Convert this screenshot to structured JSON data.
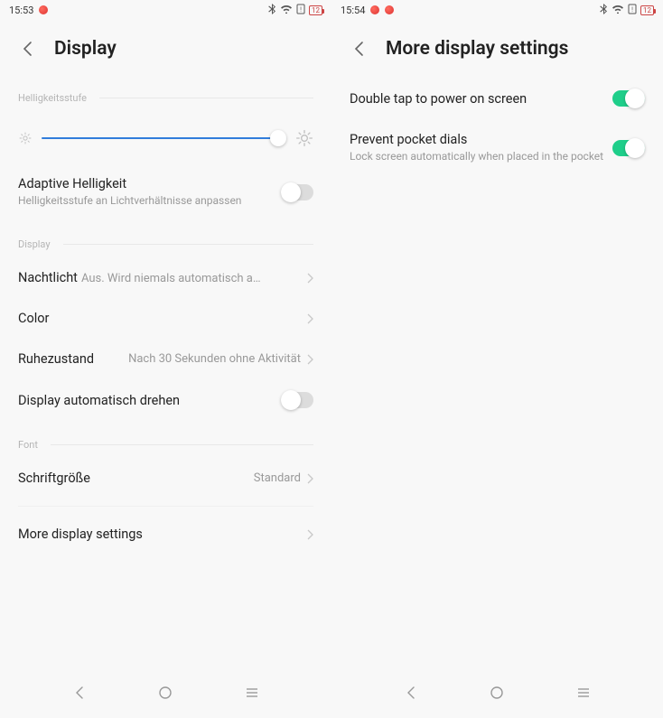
{
  "left": {
    "status": {
      "time": "15:53",
      "battery": "12"
    },
    "title": "Display",
    "sections": {
      "brightness": "Helligkeitsstufe",
      "display": "Display",
      "font": "Font"
    },
    "adaptive": {
      "title": "Adaptive Helligkeit",
      "sub": "Helligkeitsstufe an Lichtverhältnisse anpassen",
      "on": false
    },
    "nightlight": {
      "title": "Nachtlicht",
      "value": "Aus. Wird niemals automatisch aktivie…"
    },
    "color": {
      "title": "Color"
    },
    "sleep": {
      "title": "Ruhezustand",
      "value": "Nach 30 Sekunden ohne Aktivität"
    },
    "autorotate": {
      "title": "Display automatisch drehen",
      "on": false
    },
    "fontsize": {
      "title": "Schriftgröße",
      "value": "Standard"
    },
    "more": {
      "title": "More display settings"
    }
  },
  "right": {
    "status": {
      "time": "15:54",
      "battery": "12"
    },
    "title": "More display settings",
    "doubletap": {
      "title": "Double tap to power on screen",
      "on": true
    },
    "pocket": {
      "title": "Prevent pocket dials",
      "sub": "Lock screen automatically when placed in the pocket",
      "on": true
    }
  }
}
